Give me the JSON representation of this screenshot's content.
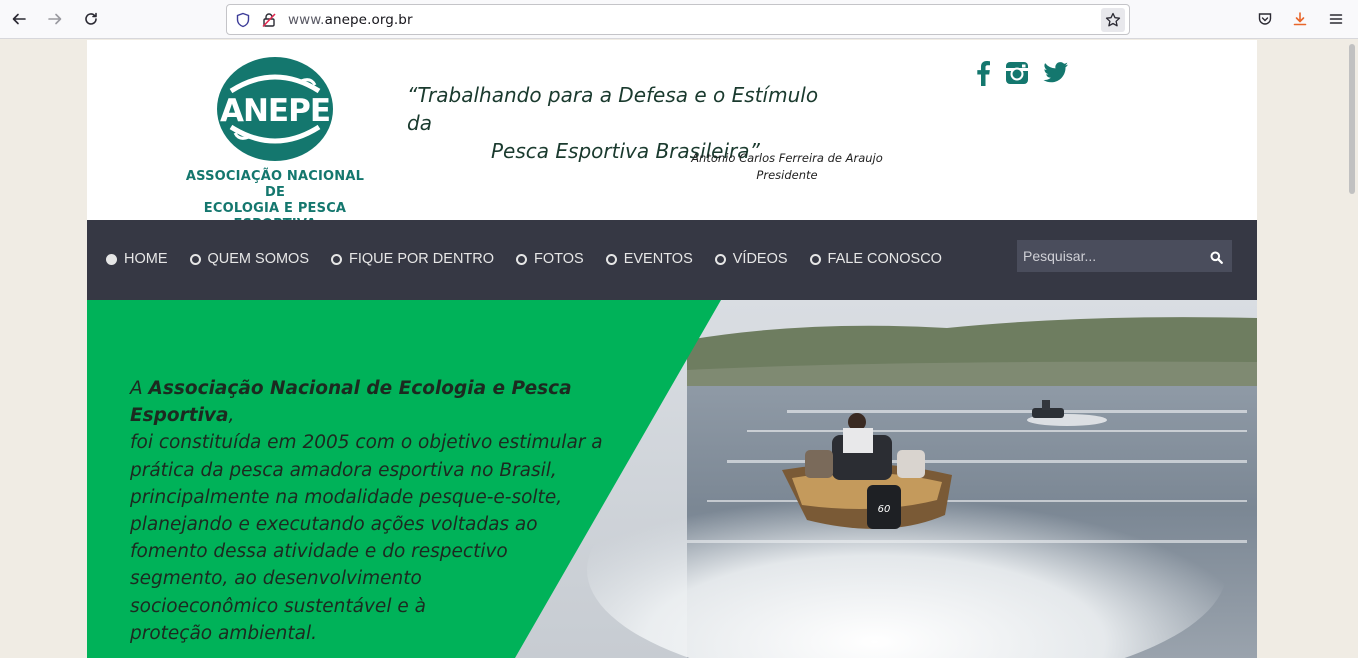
{
  "browser": {
    "url_prefix": "www.",
    "url_domain": "anepe.org.br"
  },
  "site": {
    "logo": {
      "wordmark": "ANEPE",
      "subtitle_line1": "ASSOCIAÇÃO NACIONAL DE",
      "subtitle_line2": "ECOLOGIA E PESCA ESPORTIVA"
    },
    "quote": {
      "line1": "“Trabalhando para a Defesa e o Estímulo da",
      "line2": "Pesca Esportiva Brasileira”"
    },
    "signer": {
      "name": "Antonio Carlos Ferreira de Araujo",
      "role": "Presidente"
    },
    "nav": [
      {
        "label": "HOME",
        "active": true
      },
      {
        "label": "QUEM SOMOS"
      },
      {
        "label": "FIQUE POR DENTRO"
      },
      {
        "label": "FOTOS"
      },
      {
        "label": "EVENTOS"
      },
      {
        "label": "VÍDEOS"
      },
      {
        "label": "FALE CONOSCO"
      }
    ],
    "search": {
      "placeholder": "Pesquisar..."
    },
    "hero": {
      "lead": "A ",
      "org_name": "Associação Nacional de Ecologia e Pesca Esportiva",
      "line1_rest": ",",
      "lines": [
        "foi constituída em 2005 com o objetivo estimular a",
        "prática da pesca amadora esportiva no Brasil,",
        "principalmente na modalidade pesque-e-solte,",
        "planejando e executando ações voltadas ao",
        "fomento dessa atividade e do respectivo",
        "segmento, ao desenvolvimento",
        "socioeconômico sustentável e à",
        "proteção ambiental."
      ],
      "boat_number": "60"
    },
    "colors": {
      "brand_teal": "#14776e",
      "nav_bg": "#363844",
      "hero_green": "#00b259"
    }
  }
}
